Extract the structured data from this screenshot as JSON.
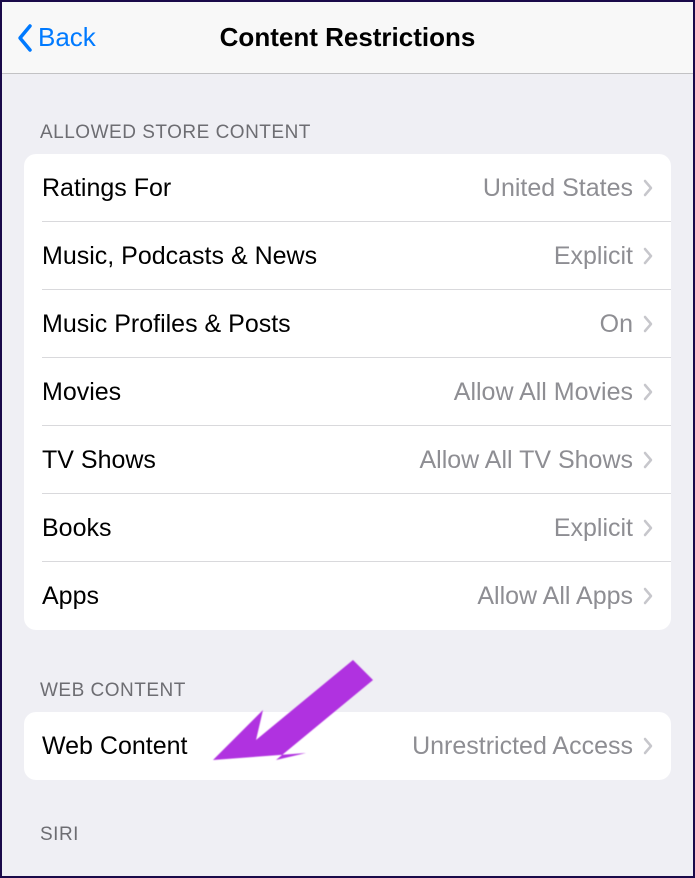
{
  "nav": {
    "back_label": "Back",
    "title": "Content Restrictions"
  },
  "sections": {
    "allowed_store": {
      "header": "ALLOWED STORE CONTENT",
      "rows": [
        {
          "label": "Ratings For",
          "value": "United States"
        },
        {
          "label": "Music, Podcasts & News",
          "value": "Explicit"
        },
        {
          "label": "Music Profiles & Posts",
          "value": "On"
        },
        {
          "label": "Movies",
          "value": "Allow All Movies"
        },
        {
          "label": "TV Shows",
          "value": "Allow All TV Shows"
        },
        {
          "label": "Books",
          "value": "Explicit"
        },
        {
          "label": "Apps",
          "value": "Allow All Apps"
        }
      ]
    },
    "web_content": {
      "header": "WEB CONTENT",
      "rows": [
        {
          "label": "Web Content",
          "value": "Unrestricted Access"
        }
      ]
    },
    "siri": {
      "header": "SIRI"
    }
  }
}
